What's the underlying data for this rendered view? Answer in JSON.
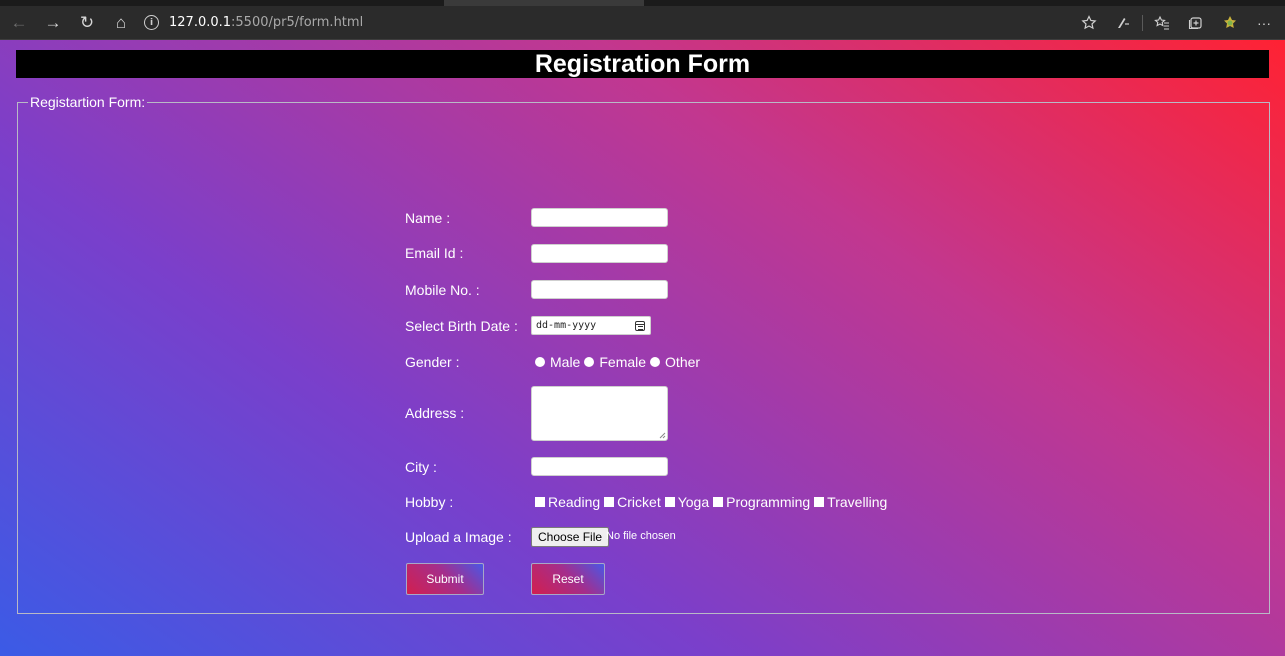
{
  "browser": {
    "address_host": "127.0.0.1",
    "address_rest": ":5500/pr5/form.html"
  },
  "icons": {
    "back": "←",
    "forward": "→",
    "refresh": "↻",
    "home": "⌂",
    "more": "···"
  },
  "page": {
    "banner_title": "Registration Form",
    "legend": "Registartion Form:"
  },
  "form": {
    "name_label": "Name :",
    "email_label": "Email Id :",
    "mobile_label": "Mobile No. :",
    "birthdate_label": "Select Birth Date :",
    "birthdate_placeholder": "dd-mm-yyyy",
    "gender_label": "Gender :",
    "gender_options": [
      "Male",
      "Female",
      "Other"
    ],
    "address_label": "Address :",
    "city_label": "City :",
    "hobby_label": "Hobby :",
    "hobby_options": [
      "Reading",
      "Cricket",
      "Yoga",
      "Programming",
      "Travelling"
    ],
    "upload_label": "Upload a Image :",
    "file_button": "Choose File",
    "file_status": "No file chosen",
    "submit_label": "Submit",
    "reset_label": "Reset"
  },
  "colors": {
    "gradient_start": "#3b5be6",
    "gradient_mid": "#c2378f",
    "gradient_end": "#ff2233",
    "banner_bg": "#000000"
  }
}
